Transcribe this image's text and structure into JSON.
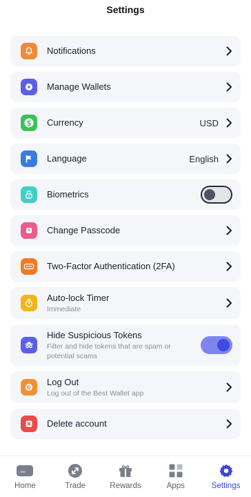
{
  "header": {
    "title": "Settings"
  },
  "settings": {
    "notifications": {
      "label": "Notifications"
    },
    "manage_wallets": {
      "label": "Manage Wallets"
    },
    "currency": {
      "label": "Currency",
      "value": "USD"
    },
    "language": {
      "label": "Language",
      "value": "English"
    },
    "biometrics": {
      "label": "Biometrics",
      "enabled": false
    },
    "change_passcode": {
      "label": "Change Passcode"
    },
    "two_factor": {
      "label": "Two-Factor Authentication (2FA)"
    },
    "auto_lock": {
      "label": "Auto-lock Timer",
      "value": "Immediate"
    },
    "hide_suspicious": {
      "label": "Hide Suspicious Tokens",
      "description": "Filter and hide tokens that are spam or potential scams",
      "enabled": true
    },
    "log_out": {
      "label": "Log Out",
      "description": "Log out of the Best Wallet app"
    },
    "delete_account": {
      "label": "Delete account"
    }
  },
  "tabbar": {
    "home": {
      "label": "Home"
    },
    "trade": {
      "label": "Trade"
    },
    "rewards": {
      "label": "Rewards"
    },
    "apps": {
      "label": "Apps"
    },
    "settings": {
      "label": "Settings",
      "active": true
    }
  },
  "colors": {
    "accent": "#3d43d8",
    "notifications_icon": "#f08a3a",
    "wallets_icon": "#5b5fe8",
    "currency_icon": "#3cc25a",
    "language_icon": "#3a7be0",
    "biometrics_icon": "#43cfc6",
    "passcode_icon": "#ee5a8c",
    "twofa_icon": "#f07a2a",
    "autolock_icon": "#f2b51c",
    "hide_icon": "#5b5fe8",
    "logout_icon": "#f0913a",
    "delete_icon": "#ec4a4a"
  },
  "icons": [
    "bell-icon",
    "wallet-icon",
    "dollar-icon",
    "flag-icon",
    "lock-icon",
    "asterisk-icon",
    "dots-icon",
    "stopwatch-icon",
    "spy-icon",
    "logout-icon",
    "x-icon",
    "chevron-right-icon",
    "home-icon",
    "trade-icon",
    "gift-icon",
    "grid-icon",
    "gear-icon"
  ]
}
